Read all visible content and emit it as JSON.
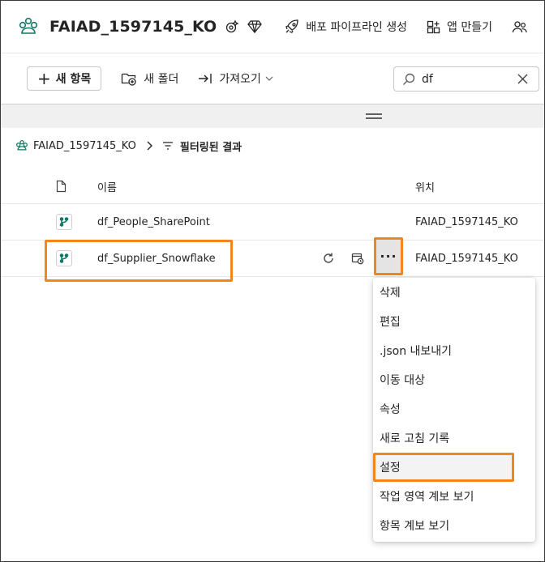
{
  "header": {
    "workspace_title": "FAIAD_1597145_KO",
    "actions": [
      {
        "label": "배포 파이프라인 생성",
        "icon": "rocket-icon"
      },
      {
        "label": "앱 만들기",
        "icon": "app-grid-icon"
      },
      {
        "label": "",
        "icon": "people-icon"
      }
    ]
  },
  "toolbar": {
    "new_item": "새 항목",
    "new_folder": "새 폴더",
    "import": "가져오기",
    "search_value": "df"
  },
  "breadcrumb": {
    "workspace": "FAIAD_1597145_KO",
    "filter_label": "필터링된 결과"
  },
  "table": {
    "col_name": "이름",
    "col_location": "위치",
    "rows": [
      {
        "name": "df_People_SharePoint",
        "location": "FAIAD_1597145_KO"
      },
      {
        "name": "df_Supplier_Snowflake",
        "location": "FAIAD_1597145_KO"
      }
    ],
    "more_label": "···"
  },
  "context_menu": {
    "items": [
      "삭제",
      "편집",
      ".json 내보내기",
      "이동 대상",
      "속성",
      "새로 고침 기록",
      "설정",
      "작업 영역 계보 보기",
      "항목 계보 보기"
    ],
    "highlighted_index": 6
  },
  "colors": {
    "accent_highlight": "#f0861c",
    "brand_green": "#117865",
    "text": "#242424"
  }
}
